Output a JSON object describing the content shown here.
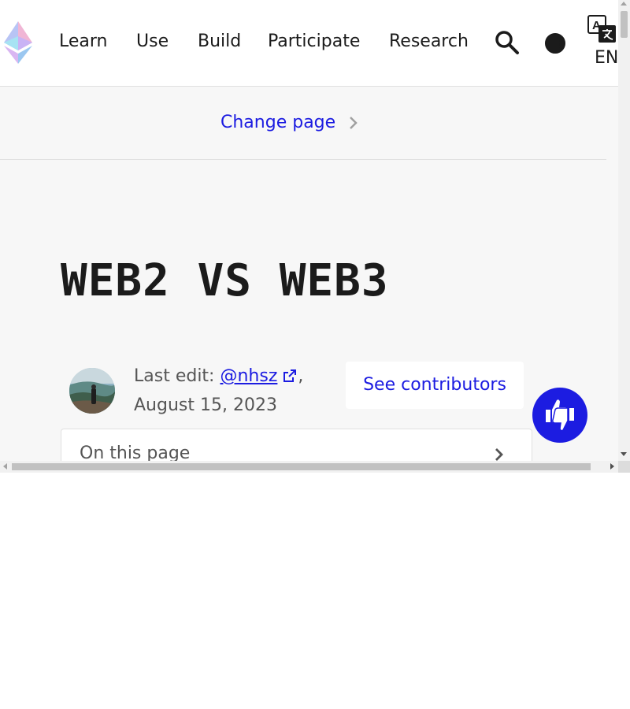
{
  "nav": {
    "links": [
      "Learn",
      "Use",
      "Build",
      "Participate",
      "Research"
    ],
    "language": "EN"
  },
  "change_page": {
    "label": "Change page"
  },
  "page": {
    "title": "WEB2 VS WEB3",
    "last_edit_label": "Last edit:",
    "author": "@nhsz",
    "date": "August 15, 2023",
    "contributors_button": "See contributors",
    "toc_label": "On this page"
  },
  "colors": {
    "accent": "#1c1ce1",
    "background": "#f7f7f7",
    "text": "#1b1b1b"
  }
}
